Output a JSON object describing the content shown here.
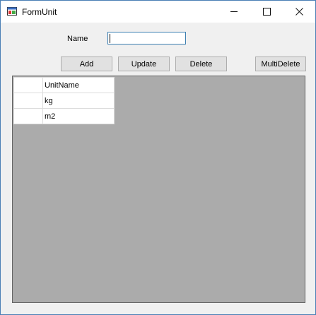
{
  "window": {
    "title": "FormUnit"
  },
  "titlebar_buttons": {
    "minimize": "—",
    "maximize": "☐",
    "close": "✕"
  },
  "form": {
    "name_label": "Name",
    "name_value": "",
    "buttons": {
      "add": "Add",
      "update": "Update",
      "delete": "Delete",
      "multi_delete": "MultiDelete"
    }
  },
  "grid": {
    "columns": [
      "UnitName"
    ],
    "rows": [
      {
        "unit_name": "kg"
      },
      {
        "unit_name": "m2"
      }
    ]
  }
}
